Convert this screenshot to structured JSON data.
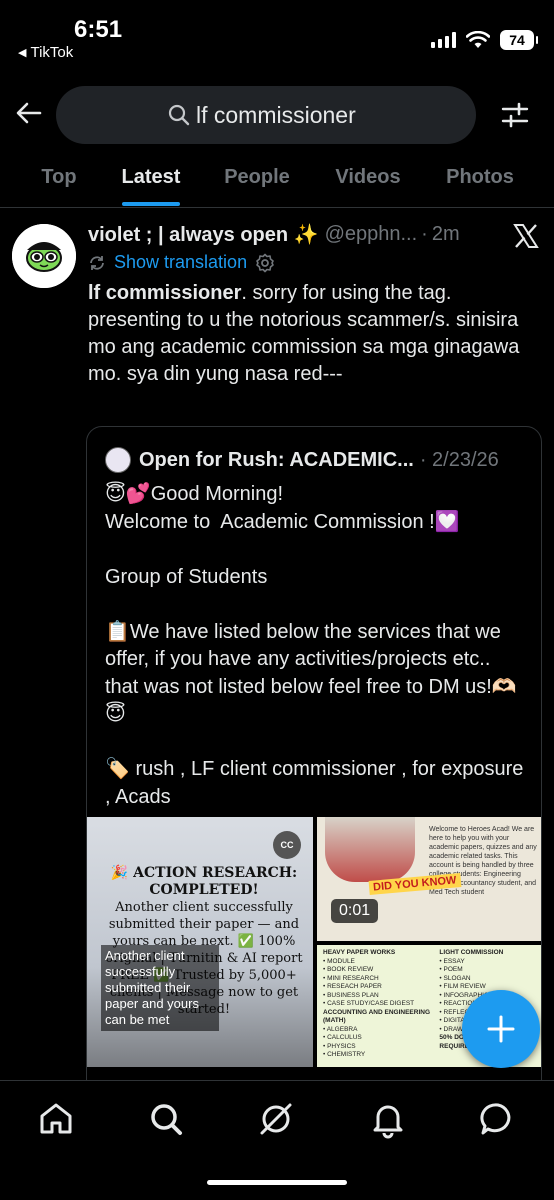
{
  "status_bar": {
    "time": "6:51",
    "back_app": "TikTok",
    "battery": "74"
  },
  "search": {
    "query": "lf commissioner"
  },
  "tabs": [
    {
      "label": "Top",
      "active": false
    },
    {
      "label": "Latest",
      "active": true
    },
    {
      "label": "People",
      "active": false
    },
    {
      "label": "Videos",
      "active": false
    },
    {
      "label": "Photos",
      "active": false
    }
  ],
  "post": {
    "display_name": "violet ; | always open ✨",
    "handle": "@epphn...",
    "dot": "·",
    "time_ago": "2m",
    "show_translation": "Show translation",
    "text_bold": "lf commissioner",
    "text_rest": ". sorry for using the tag. presenting to u the notorious scammer/s.  sinisira mo ang academic commission sa mga ginagawa mo. sya din yung nasa red---",
    "quote": {
      "name": "Open for Rush: ACADEMIC...",
      "date": "· 2/23/26",
      "text": "😇💕Good Morning!\nWelcome to  Academic Commission !💟\n\nGroup of Students\n\n📋We have listed below the services that we offer, if you have any activities/projects etc.. that was not listed below feel free to DM us!🫶🏻😇\n\n🏷️ rush , LF client commissioner , for exposure , Acads",
      "media": {
        "image1": {
          "title": "🎉 ACTION RESEARCH: COMPLETED!",
          "body": "Another client successfully submitted their paper — and yours can be next. ✅ 100% original | Turnitin & AI report FREE ✅ Trusted by 5,000+ clients | Message now to get started!",
          "caption_overlay": "Another client successfully submitted their paper and yours can be met",
          "cc": "CC"
        },
        "image2": {
          "duration": "0:01",
          "badge": "DID YOU KNOW",
          "text": "Welcome to Heroes Acad! We are here to help you with your academic papers, quizzes and any academic related tasks. This account is being handled by three college students: Engineering student, Accountancy student, and Med Tech student"
        },
        "image3": {
          "col1": [
            "HEAVY PAPER WORKS",
            "• MODULE",
            "• BOOK REVIEW",
            "• MINI RESEARCH",
            "• RESEACH PAPER",
            "• BUSINESS PLAN",
            "• CASE STUDY/CASE DIGEST",
            "ACCOUNTING AND ENGINEERING (MATH)",
            "• ALGEBRA",
            "• CALCULUS",
            "• PHYSICS",
            "• CHEMISTRY"
          ],
          "col2": [
            "LIGHT COMMISSION",
            "• ESSAY",
            "• POEM",
            "• SLOGAN",
            "• FILM REVIEW",
            "• INFOGRAPHICS",
            "• REACTION PAPER",
            "• REFLECTION",
            "• DIGITAL ART",
            "• DRAWING",
            "50% DOWNPAYMENT IS REQUIRED"
          ]
        }
      }
    }
  },
  "colors": {
    "accent": "#1d9bf0",
    "background": "#000000",
    "muted": "#71767b",
    "text": "#e7e9ea"
  },
  "icons": {
    "back": "arrow-left-icon",
    "search": "search-icon",
    "filter": "filter-sliders-icon",
    "x": "x-logo-icon",
    "translate": "translate-icon",
    "settings": "gear-icon",
    "fab": "plus-icon",
    "nav": [
      "home-icon",
      "search-icon",
      "grok-icon",
      "bell-icon",
      "mail-icon"
    ]
  }
}
